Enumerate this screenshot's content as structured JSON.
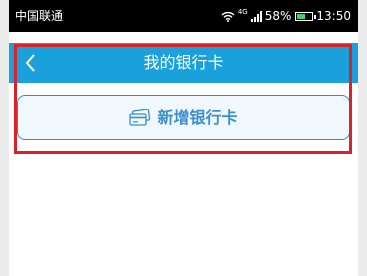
{
  "status_bar": {
    "carrier": "中国联通",
    "network": "4G",
    "battery_percent": "58%",
    "battery_level": 0.58,
    "time": "13:50",
    "icons": [
      "wifi-icon",
      "signal-icon",
      "battery-icon"
    ]
  },
  "nav": {
    "title": "我的银行卡",
    "back_icon": "chevron-left-icon"
  },
  "main": {
    "add_card_label": "新增银行卡",
    "add_card_icon": "bank-card-icon"
  },
  "colors": {
    "nav_background": "#1aa1dc",
    "button_border": "#2b8fd0",
    "button_text": "#3a8fd0",
    "highlight": "#d8232a"
  }
}
